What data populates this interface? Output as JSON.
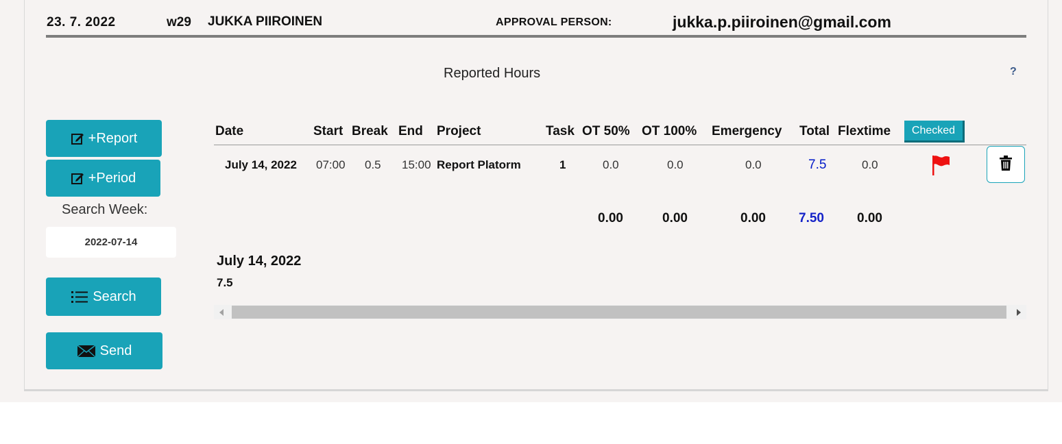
{
  "header": {
    "date": "23. 7.  2022",
    "week": "w29",
    "name": "JUKKA PIIROINEN",
    "approval_label": "APPROVAL PERSON:",
    "approval_email": "jukka.p.piiroinen@gmail.com"
  },
  "section": {
    "title": "Reported Hours",
    "help": "?"
  },
  "sidebar": {
    "report_label": "+Report",
    "period_label": "+Period",
    "search_week_label": "Search Week:",
    "search_week_value": "2022-07-14",
    "search_label": "Search",
    "send_label": "Send"
  },
  "table": {
    "headers": {
      "date": "Date",
      "start": "Start",
      "break": "Break",
      "end": "End",
      "project": "Project",
      "task": "Task",
      "ot50": "OT 50%",
      "ot100": "OT 100%",
      "emergency": "Emergency",
      "total": "Total",
      "flextime": "Flextime",
      "checked": "Checked"
    },
    "rows": [
      {
        "date": "July 14, 2022",
        "start": "07:00",
        "break": "0.5",
        "end": "15:00",
        "project": "Report Platorm",
        "task": "1",
        "ot50": "0.0",
        "ot100": "0.0",
        "emergency": "0.0",
        "total": "7.5",
        "flextime": "0.0"
      }
    ],
    "totals": {
      "ot50": "0.00",
      "ot100": "0.00",
      "emergency": "0.00",
      "total": "7.50",
      "flextime": "0.00"
    }
  },
  "day_summary": {
    "date": "July 14, 2022",
    "total": "7.5"
  },
  "colors": {
    "accent": "#19a3b8",
    "total_blue": "#0019c8",
    "flag_red": "#ee1111"
  },
  "icons": {
    "report": "edit-icon",
    "period": "edit-icon",
    "search": "list-icon",
    "send": "envelope-icon",
    "flag": "flag-icon",
    "delete": "trash-icon"
  }
}
